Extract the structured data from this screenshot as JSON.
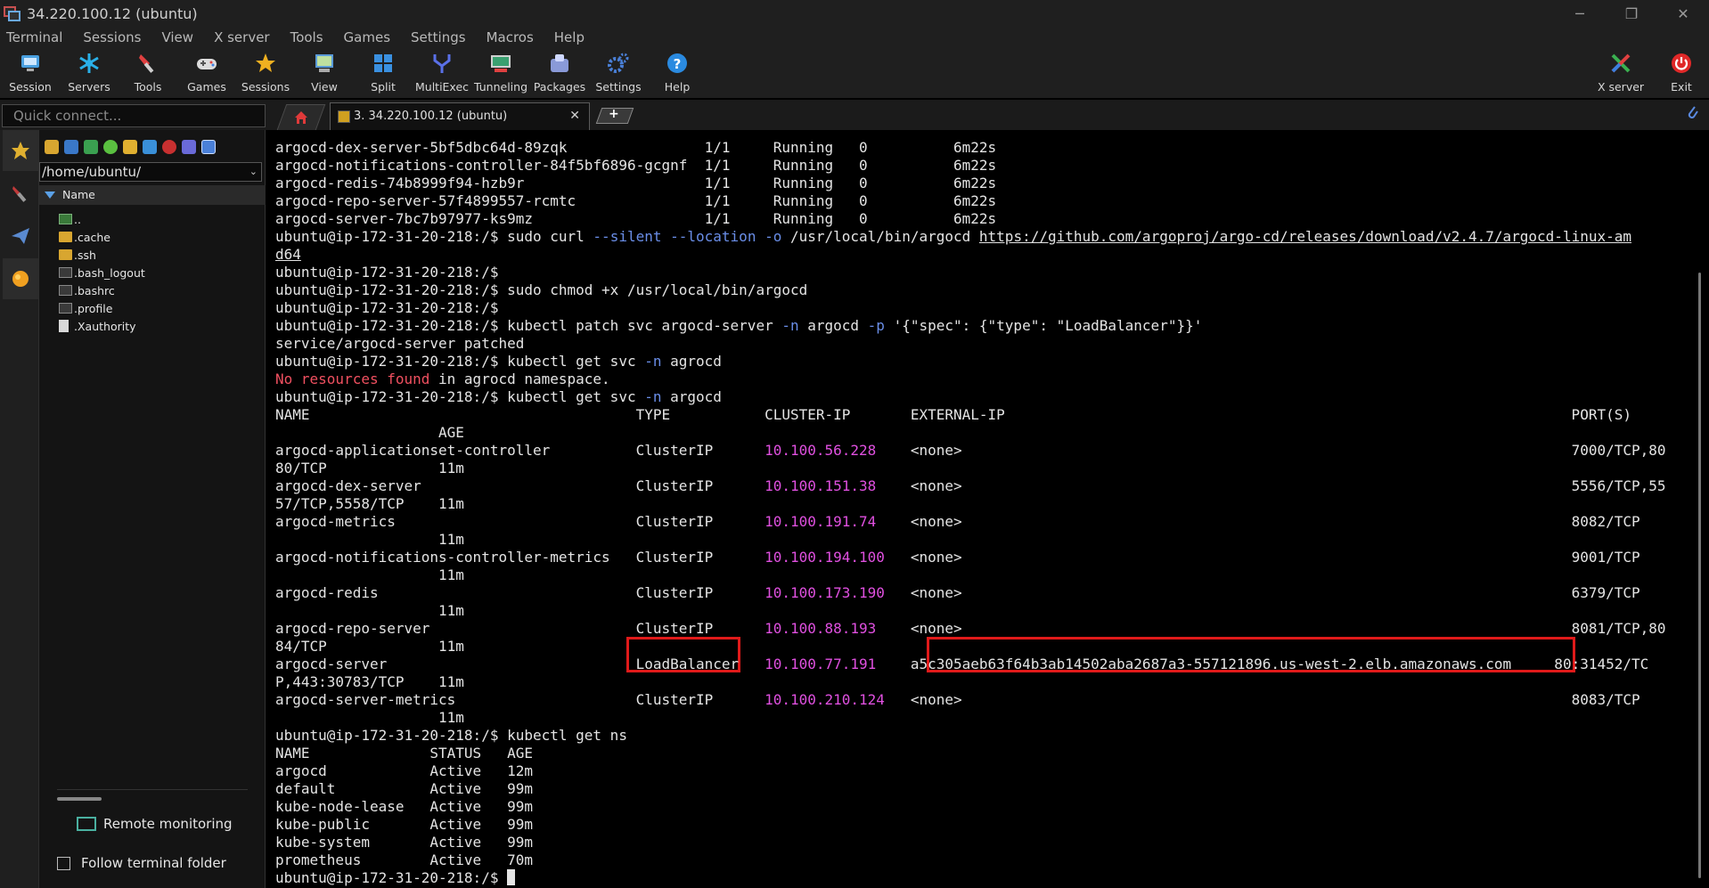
{
  "window": {
    "title": "34.220.100.12 (ubuntu)",
    "controls": {
      "minimize": "─",
      "restore": "❐",
      "close": "✕"
    }
  },
  "menu": [
    "Terminal",
    "Sessions",
    "View",
    "X server",
    "Tools",
    "Games",
    "Settings",
    "Macros",
    "Help"
  ],
  "toolbar": [
    {
      "label": "Session",
      "icon": "session-icon"
    },
    {
      "label": "Servers",
      "icon": "servers-icon"
    },
    {
      "label": "Tools",
      "icon": "tools-icon"
    },
    {
      "label": "Games",
      "icon": "games-icon"
    },
    {
      "label": "Sessions",
      "icon": "star-icon"
    },
    {
      "label": "View",
      "icon": "view-icon"
    },
    {
      "label": "Split",
      "icon": "split-icon"
    },
    {
      "label": "MultiExec",
      "icon": "multiexec-icon"
    },
    {
      "label": "Tunneling",
      "icon": "tunneling-icon"
    },
    {
      "label": "Packages",
      "icon": "packages-icon"
    },
    {
      "label": "Settings",
      "icon": "gear-icon"
    },
    {
      "label": "Help",
      "icon": "help-icon"
    }
  ],
  "toolbar_right": [
    {
      "label": "X server",
      "icon": "x-server-icon"
    },
    {
      "label": "Exit",
      "icon": "power-icon"
    }
  ],
  "quick_connect": {
    "placeholder": "Quick connect..."
  },
  "tabs": {
    "session_tab": "3. 34.220.100.12 (ubuntu)",
    "close": "✕",
    "new_tab": "+"
  },
  "sidebar": {
    "path": "/home/ubuntu/",
    "column": "Name",
    "files": [
      {
        "name": "..",
        "type": "up"
      },
      {
        "name": ".cache",
        "type": "dir"
      },
      {
        "name": ".ssh",
        "type": "dir"
      },
      {
        "name": ".bash_logout",
        "type": "doc"
      },
      {
        "name": ".bashrc",
        "type": "doc"
      },
      {
        "name": ".profile",
        "type": "doc"
      },
      {
        "name": ".Xauthority",
        "type": "page"
      }
    ],
    "remote_monitoring": "Remote monitoring",
    "follow_folder": "Follow terminal folder"
  },
  "terminal": {
    "lines": [
      [
        {
          "t": "argocd-dex-server-5bf5dbc64d-89zqk                1/1     Running   0          6m22s"
        }
      ],
      [
        {
          "t": "argocd-notifications-controller-84f5bf6896-gcgnf  1/1     Running   0          6m22s"
        }
      ],
      [
        {
          "t": "argocd-redis-74b8999f94-hzb9r                     1/1     Running   0          6m22s"
        }
      ],
      [
        {
          "t": "argocd-repo-server-57f4899557-rcmtc               1/1     Running   0          6m22s"
        }
      ],
      [
        {
          "t": "argocd-server-7bc7b97977-ks9mz                    1/1     Running   0          6m22s"
        }
      ],
      [
        {
          "t": "ubuntu@ip-172-31-20-218:/$ sudo curl "
        },
        {
          "t": "--silent --location -o",
          "c": "b"
        },
        {
          "t": " /usr/local/bin/argocd "
        },
        {
          "t": "https://github.com/argoproj/argo-cd/releases/download/v2.4.7/argocd-linux-am",
          "c": "u"
        }
      ],
      [
        {
          "t": "d64",
          "c": "u"
        }
      ],
      [
        {
          "t": "ubuntu@ip-172-31-20-218:/$"
        }
      ],
      [
        {
          "t": "ubuntu@ip-172-31-20-218:/$ sudo chmod +x /usr/local/bin/argocd"
        }
      ],
      [
        {
          "t": "ubuntu@ip-172-31-20-218:/$"
        }
      ],
      [
        {
          "t": "ubuntu@ip-172-31-20-218:/$ kubectl patch svc argocd-server "
        },
        {
          "t": "-n",
          "c": "b"
        },
        {
          "t": " argocd "
        },
        {
          "t": "-p",
          "c": "b"
        },
        {
          "t": " '{\"spec\": {\"type\": \"LoadBalancer\"}}'"
        }
      ],
      [
        {
          "t": "service/argocd-server patched"
        }
      ],
      [
        {
          "t": "ubuntu@ip-172-31-20-218:/$ kubectl get svc "
        },
        {
          "t": "-n",
          "c": "b"
        },
        {
          "t": " agrocd"
        }
      ],
      [
        {
          "t": "No resources found",
          "c": "r"
        },
        {
          "t": " in agrocd namespace."
        }
      ],
      [
        {
          "t": "ubuntu@ip-172-31-20-218:/$ kubectl get svc "
        },
        {
          "t": "-n",
          "c": "b"
        },
        {
          "t": " argocd"
        }
      ],
      [
        {
          "t": "NAME                                      TYPE           CLUSTER-IP       EXTERNAL-IP                                                                  PORT(S)"
        }
      ],
      [
        {
          "t": "                   AGE"
        }
      ],
      [
        {
          "t": "argocd-applicationset-controller          ClusterIP      "
        },
        {
          "t": "10.100.56.228",
          "c": "m"
        },
        {
          "t": "    <none>                                                                       7000/TCP,80"
        }
      ],
      [
        {
          "t": "80/TCP             11m"
        }
      ],
      [
        {
          "t": "argocd-dex-server                         ClusterIP      "
        },
        {
          "t": "10.100.151.38",
          "c": "m"
        },
        {
          "t": "    <none>                                                                       5556/TCP,55"
        }
      ],
      [
        {
          "t": "57/TCP,5558/TCP    11m"
        }
      ],
      [
        {
          "t": "argocd-metrics                            ClusterIP      "
        },
        {
          "t": "10.100.191.74",
          "c": "m"
        },
        {
          "t": "    <none>                                                                       8082/TCP"
        }
      ],
      [
        {
          "t": "                   11m"
        }
      ],
      [
        {
          "t": "argocd-notifications-controller-metrics   ClusterIP      "
        },
        {
          "t": "10.100.194.100",
          "c": "m"
        },
        {
          "t": "   <none>                                                                       9001/TCP"
        }
      ],
      [
        {
          "t": "                   11m"
        }
      ],
      [
        {
          "t": "argocd-redis                              ClusterIP      "
        },
        {
          "t": "10.100.173.190",
          "c": "m"
        },
        {
          "t": "   <none>                                                                       6379/TCP"
        }
      ],
      [
        {
          "t": "                   11m"
        }
      ],
      [
        {
          "t": "argocd-repo-server                        ClusterIP      "
        },
        {
          "t": "10.100.88.193",
          "c": "m"
        },
        {
          "t": "    <none>                                                                       8081/TCP,80"
        }
      ],
      [
        {
          "t": "84/TCP             11m"
        }
      ],
      [
        {
          "t": "argocd-server                             LoadBalancer   "
        },
        {
          "t": "10.100.77.191",
          "c": "m"
        },
        {
          "t": "    a5c305aeb63f64b3ab14502aba2687a3-557121896.us-west-2.elb.amazonaws.com     80:31452/TC"
        }
      ],
      [
        {
          "t": "P,443:30783/TCP    11m"
        }
      ],
      [
        {
          "t": "argocd-server-metrics                     ClusterIP      "
        },
        {
          "t": "10.100.210.124",
          "c": "m"
        },
        {
          "t": "   <none>                                                                       8083/TCP"
        }
      ],
      [
        {
          "t": "                   11m"
        }
      ],
      [
        {
          "t": "ubuntu@ip-172-31-20-218:/$ kubectl get ns"
        }
      ],
      [
        {
          "t": "NAME              STATUS   AGE"
        }
      ],
      [
        {
          "t": "argocd            Active   12m"
        }
      ],
      [
        {
          "t": "default           Active   99m"
        }
      ],
      [
        {
          "t": "kube-node-lease   Active   99m"
        }
      ],
      [
        {
          "t": "kube-public       Active   99m"
        }
      ],
      [
        {
          "t": "kube-system       Active   99m"
        }
      ],
      [
        {
          "t": "prometheus        Active   70m"
        }
      ],
      [
        {
          "t": "ubuntu@ip-172-31-20-218:/$ "
        }
      ]
    ]
  },
  "colors": {
    "option_flag": "#6a8ee8",
    "cluster_ip": "#e050e0",
    "error_text": "#f05060",
    "annotation_box": "#e01a1a",
    "terminal_bg": "#000000"
  }
}
